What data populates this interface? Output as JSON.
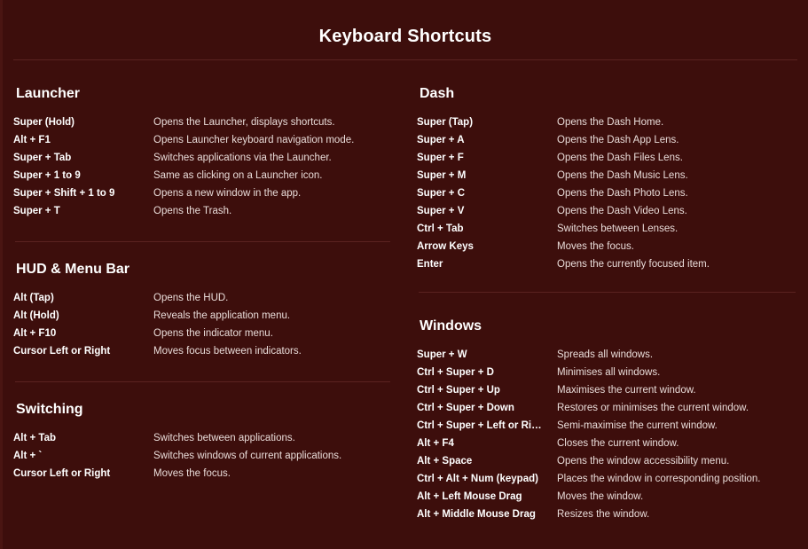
{
  "window": {
    "title": "Keyboard Shortcuts",
    "background_color": "#3d0e0c",
    "rule_color": "#5a2220",
    "key_text_color": "#ffffff",
    "desc_text_color": "#e9dcd9"
  },
  "columns": [
    {
      "name": "left",
      "sections": [
        {
          "heading": "Launcher",
          "rows": [
            {
              "key": "Super (Hold)",
              "desc": "Opens the Launcher, displays shortcuts."
            },
            {
              "key": "Alt + F1",
              "desc": "Opens Launcher keyboard navigation mode."
            },
            {
              "key": "Super + Tab",
              "desc": "Switches applications via the Launcher."
            },
            {
              "key": "Super + 1 to 9",
              "desc": "Same as clicking on a Launcher icon."
            },
            {
              "key": "Super + Shift + 1 to 9",
              "desc": "Opens a new window in the app."
            },
            {
              "key": "Super + T",
              "desc": "Opens the Trash."
            }
          ]
        },
        {
          "heading": "HUD & Menu Bar",
          "rows": [
            {
              "key": "Alt (Tap)",
              "desc": "Opens the HUD."
            },
            {
              "key": "Alt (Hold)",
              "desc": "Reveals the application menu."
            },
            {
              "key": "Alt + F10",
              "desc": "Opens the indicator menu."
            },
            {
              "key": "Cursor Left or Right",
              "desc": "Moves focus between indicators."
            }
          ]
        },
        {
          "heading": "Switching",
          "rows": [
            {
              "key": "Alt + Tab",
              "desc": "Switches between applications."
            },
            {
              "key": "Alt + `",
              "desc": "Switches windows of current applications."
            },
            {
              "key": "Cursor Left or Right",
              "desc": "Moves the focus."
            }
          ]
        }
      ]
    },
    {
      "name": "right",
      "sections": [
        {
          "heading": "Dash",
          "rows": [
            {
              "key": "Super (Tap)",
              "desc": "Opens the Dash Home."
            },
            {
              "key": "Super + A",
              "desc": "Opens the Dash App Lens."
            },
            {
              "key": "Super + F",
              "desc": "Opens the Dash Files Lens."
            },
            {
              "key": "Super + M",
              "desc": "Opens the Dash Music Lens."
            },
            {
              "key": "Super + C",
              "desc": "Opens the Dash Photo Lens."
            },
            {
              "key": "Super + V",
              "desc": "Opens the Dash Video Lens."
            },
            {
              "key": "Ctrl + Tab",
              "desc": "Switches between Lenses."
            },
            {
              "key": "Arrow Keys",
              "desc": "Moves the focus."
            },
            {
              "key": "Enter",
              "desc": "Opens the currently focused item."
            }
          ]
        },
        {
          "heading": "Windows",
          "rows": [
            {
              "key": "Super + W",
              "desc": "Spreads all windows."
            },
            {
              "key": "Ctrl + Super + D",
              "desc": "Minimises all windows."
            },
            {
              "key": "Ctrl + Super + Up",
              "desc": "Maximises the current window."
            },
            {
              "key": "Ctrl + Super + Down",
              "desc": "Restores or minimises the current window."
            },
            {
              "key": "Ctrl + Super + Left or Ri…",
              "desc": "Semi-maximise the current window."
            },
            {
              "key": "Alt + F4",
              "desc": "Closes the current window."
            },
            {
              "key": "Alt + Space",
              "desc": "Opens the window accessibility menu."
            },
            {
              "key": "Ctrl + Alt + Num (keypad)",
              "desc": "Places the window in corresponding position."
            },
            {
              "key": "Alt + Left Mouse Drag",
              "desc": "Moves the window."
            },
            {
              "key": "Alt + Middle Mouse Drag",
              "desc": "Resizes the window."
            }
          ]
        }
      ]
    }
  ]
}
